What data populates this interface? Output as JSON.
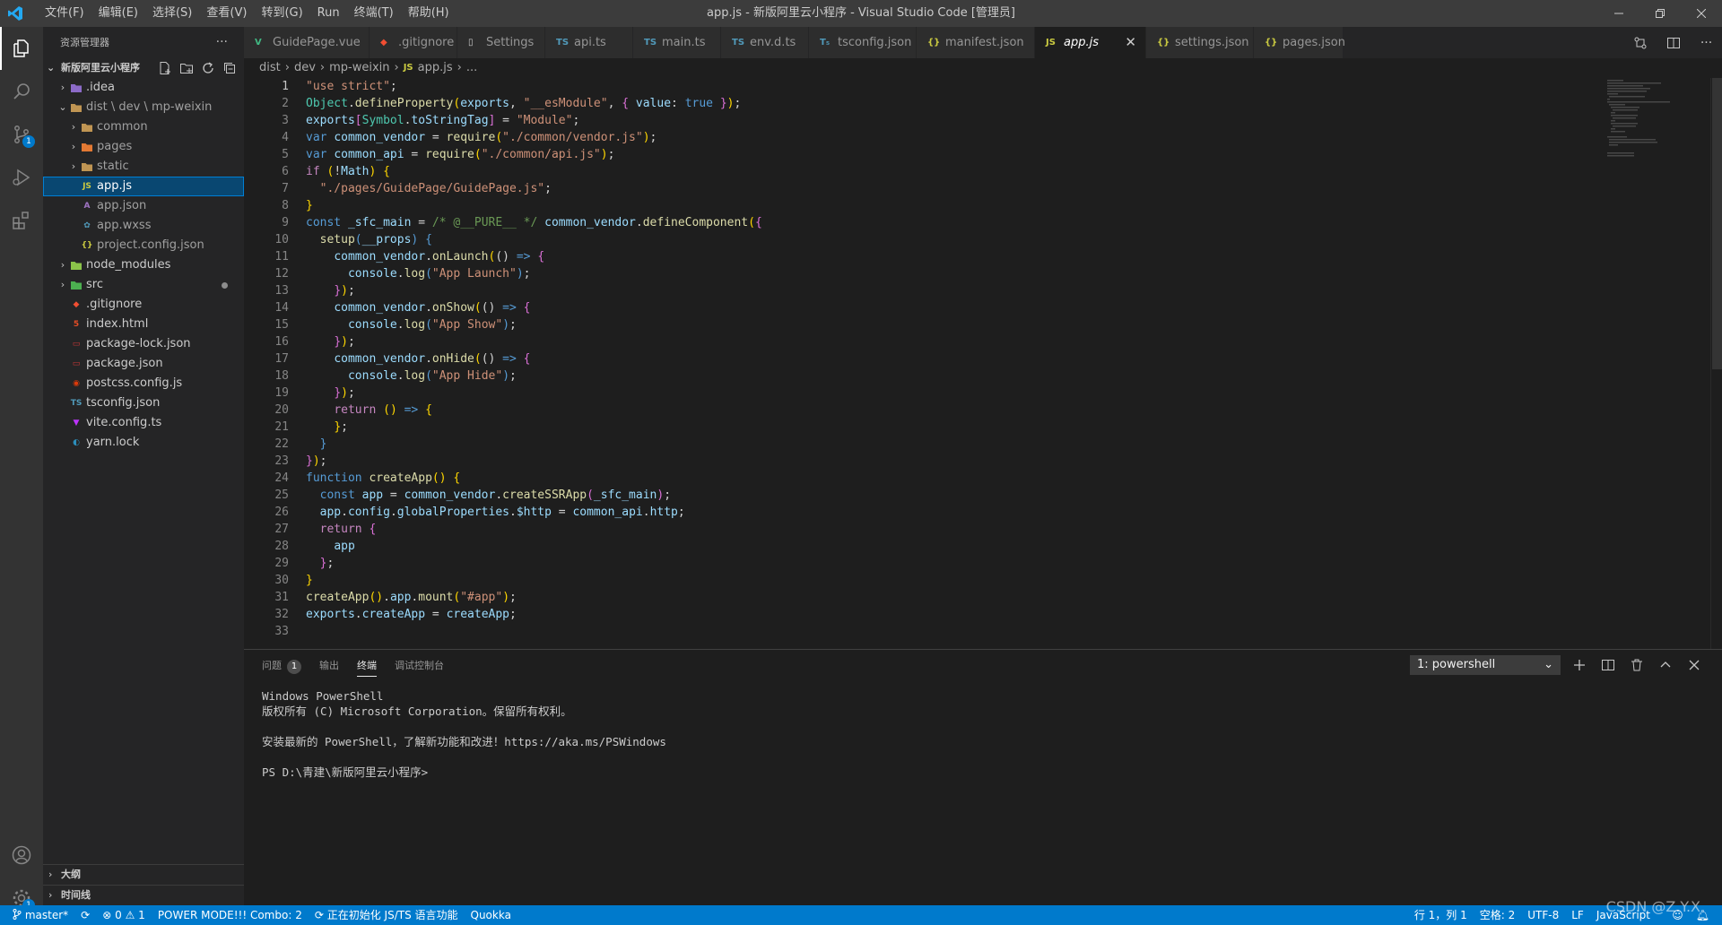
{
  "window": {
    "title": "app.js - 新版阿里云小程序 - Visual Studio Code [管理员]",
    "menu": [
      "文件(F)",
      "编辑(E)",
      "选择(S)",
      "查看(V)",
      "转到(G)",
      "Run",
      "终端(T)",
      "帮助(H)"
    ]
  },
  "activity_bar": {
    "source_control_badge": "1",
    "settings_badge": "1"
  },
  "sidebar": {
    "title": "资源管理器",
    "more": "···",
    "folder": "新版阿里云小程序",
    "tree": [
      {
        "label": "idea",
        "display": ".idea",
        "depth": 1,
        "chevron": "›",
        "icon": "folder-idea"
      },
      {
        "display": "dist \\ dev \\ mp-weixin",
        "depth": 1,
        "chevron": "⌄",
        "icon": "folder-dist"
      },
      {
        "display": "common",
        "depth": 2,
        "chevron": "›",
        "icon": "folder"
      },
      {
        "display": "pages",
        "depth": 2,
        "chevron": "›",
        "icon": "folder-pages"
      },
      {
        "display": "static",
        "depth": 2,
        "chevron": "›",
        "icon": "folder"
      },
      {
        "display": "app.js",
        "depth": 2,
        "icon": "js",
        "selected": true
      },
      {
        "display": "app.json",
        "depth": 2,
        "icon": "json-app"
      },
      {
        "display": "app.wxss",
        "depth": 2,
        "icon": "wxss"
      },
      {
        "display": "project.config.json",
        "depth": 2,
        "icon": "json"
      },
      {
        "display": "node_modules",
        "depth": 1,
        "chevron": "›",
        "icon": "folder-node"
      },
      {
        "display": "src",
        "depth": 1,
        "chevron": "›",
        "icon": "folder-src",
        "dot": true
      },
      {
        "display": ".gitignore",
        "depth": 1,
        "icon": "git"
      },
      {
        "display": "index.html",
        "depth": 1,
        "icon": "html"
      },
      {
        "display": "package-lock.json",
        "depth": 1,
        "icon": "npm"
      },
      {
        "display": "package.json",
        "depth": 1,
        "icon": "npm"
      },
      {
        "display": "postcss.config.js",
        "depth": 1,
        "icon": "postcss"
      },
      {
        "display": "tsconfig.json",
        "depth": 1,
        "icon": "ts"
      },
      {
        "display": "vite.config.ts",
        "depth": 1,
        "icon": "vite"
      },
      {
        "display": "yarn.lock",
        "depth": 1,
        "icon": "yarn"
      }
    ],
    "outline_label": "大纲",
    "timeline_label": "时间线"
  },
  "tabs": [
    {
      "label": "GuidePage.vue",
      "icon": "V",
      "color": "#41b883"
    },
    {
      "label": ".gitignore",
      "icon": "◆",
      "color": "#f14e32"
    },
    {
      "label": "Settings",
      "icon": "▯",
      "color": "#cccccc"
    },
    {
      "label": "api.ts",
      "icon": "TS",
      "color": "#519aba"
    },
    {
      "label": "main.ts",
      "icon": "TS",
      "color": "#519aba"
    },
    {
      "label": "env.d.ts",
      "icon": "TS",
      "color": "#519aba"
    },
    {
      "label": "tsconfig.json",
      "icon": "T₅",
      "color": "#519aba"
    },
    {
      "label": "manifest.json",
      "icon": "{}",
      "color": "#cbcb41"
    },
    {
      "label": "app.js",
      "icon": "JS",
      "color": "#cbcb41",
      "active": true,
      "close": "✕"
    },
    {
      "label": "settings.json",
      "icon": "{}",
      "color": "#cbcb41"
    },
    {
      "label": "pages.json",
      "icon": "{}",
      "color": "#cbcb41"
    }
  ],
  "breadcrumb": [
    "dist",
    "dev",
    "mp-weixin",
    "app.js",
    "..."
  ],
  "editor": {
    "current_line": 1,
    "lines": [
      [
        [
          "\"use strict\"",
          "s"
        ],
        [
          ";",
          ""
        ]
      ],
      [
        [
          "Object",
          "t"
        ],
        [
          ".",
          "",
          ""
        ],
        [
          "defineProperty",
          "f"
        ],
        [
          "(",
          "g"
        ],
        [
          "exports",
          "v"
        ],
        [
          ", ",
          ""
        ],
        [
          "\"__esModule\"",
          "s"
        ],
        [
          ", ",
          ""
        ],
        [
          "{",
          "b"
        ],
        [
          " ",
          ""
        ],
        [
          "value",
          "v"
        ],
        [
          ": ",
          ""
        ],
        [
          "true",
          "k"
        ],
        [
          " ",
          ""
        ],
        [
          "}",
          "b"
        ],
        [
          ")",
          "g"
        ],
        [
          ";",
          ""
        ]
      ],
      [
        [
          "exports",
          "v"
        ],
        [
          "[",
          "b"
        ],
        [
          "Symbol",
          "t"
        ],
        [
          ".",
          ""
        ],
        [
          "toStringTag",
          "v"
        ],
        [
          "]",
          "b"
        ],
        [
          " = ",
          ""
        ],
        [
          "\"Module\"",
          "s"
        ],
        [
          ";",
          ""
        ]
      ],
      [
        [
          "var",
          "k"
        ],
        [
          " ",
          ""
        ],
        [
          "common_vendor",
          "v"
        ],
        [
          " = ",
          ""
        ],
        [
          "require",
          "f"
        ],
        [
          "(",
          "g"
        ],
        [
          "\"./common/vendor.js\"",
          "s"
        ],
        [
          ")",
          "g"
        ],
        [
          ";",
          ""
        ]
      ],
      [
        [
          "var",
          "k"
        ],
        [
          " ",
          ""
        ],
        [
          "common_api",
          "v"
        ],
        [
          " = ",
          ""
        ],
        [
          "require",
          "f"
        ],
        [
          "(",
          "g"
        ],
        [
          "\"./common/api.js\"",
          "s"
        ],
        [
          ")",
          "g"
        ],
        [
          ";",
          ""
        ]
      ],
      [
        [
          "if",
          "p"
        ],
        [
          " ",
          ""
        ],
        [
          "(",
          "g"
        ],
        [
          "!",
          ""
        ],
        [
          "Math",
          "v"
        ],
        [
          ")",
          "g"
        ],
        [
          " ",
          ""
        ],
        [
          "{",
          "g"
        ]
      ],
      [
        [
          "  ",
          ""
        ],
        [
          "\"./pages/GuidePage/GuidePage.js\"",
          "s"
        ],
        [
          ";",
          ""
        ]
      ],
      [
        [
          "}",
          "g"
        ]
      ],
      [
        [
          "const",
          "k"
        ],
        [
          " ",
          ""
        ],
        [
          "_sfc_main",
          "v"
        ],
        [
          " = ",
          ""
        ],
        [
          "/* @__PURE__ */",
          "c"
        ],
        [
          " ",
          ""
        ],
        [
          "common_vendor",
          "v"
        ],
        [
          ".",
          ""
        ],
        [
          "defineComponent",
          "f"
        ],
        [
          "(",
          "g"
        ],
        [
          "{",
          "b"
        ]
      ],
      [
        [
          "  ",
          ""
        ],
        [
          "setup",
          "f"
        ],
        [
          "(",
          "k"
        ],
        [
          "__props",
          "v"
        ],
        [
          ")",
          "k"
        ],
        [
          " ",
          ""
        ],
        [
          "{",
          "k"
        ]
      ],
      [
        [
          "    ",
          ""
        ],
        [
          "common_vendor",
          "v"
        ],
        [
          ".",
          ""
        ],
        [
          "onLaunch",
          "f"
        ],
        [
          "(",
          "g"
        ],
        [
          "(",
          ""
        ],
        [
          ")",
          ""
        ],
        [
          " => ",
          "k"
        ],
        [
          "{",
          "b"
        ]
      ],
      [
        [
          "      ",
          ""
        ],
        [
          "console",
          "v"
        ],
        [
          ".",
          ""
        ],
        [
          "log",
          "f"
        ],
        [
          "(",
          "k"
        ],
        [
          "\"App Launch\"",
          "s"
        ],
        [
          ")",
          "k"
        ],
        [
          ";",
          ""
        ]
      ],
      [
        [
          "    ",
          ""
        ],
        [
          "}",
          "b"
        ],
        [
          ")",
          "g"
        ],
        [
          ";",
          ""
        ]
      ],
      [
        [
          "    ",
          ""
        ],
        [
          "common_vendor",
          "v"
        ],
        [
          ".",
          ""
        ],
        [
          "onShow",
          "f"
        ],
        [
          "(",
          "g"
        ],
        [
          "(",
          ""
        ],
        [
          ")",
          ""
        ],
        [
          " => ",
          "k"
        ],
        [
          "{",
          "b"
        ]
      ],
      [
        [
          "      ",
          ""
        ],
        [
          "console",
          "v"
        ],
        [
          ".",
          ""
        ],
        [
          "log",
          "f"
        ],
        [
          "(",
          "k"
        ],
        [
          "\"App Show\"",
          "s"
        ],
        [
          ")",
          "k"
        ],
        [
          ";",
          ""
        ]
      ],
      [
        [
          "    ",
          ""
        ],
        [
          "}",
          "b"
        ],
        [
          ")",
          "g"
        ],
        [
          ";",
          ""
        ]
      ],
      [
        [
          "    ",
          ""
        ],
        [
          "common_vendor",
          "v"
        ],
        [
          ".",
          ""
        ],
        [
          "onHide",
          "f"
        ],
        [
          "(",
          "g"
        ],
        [
          "(",
          ""
        ],
        [
          ")",
          ""
        ],
        [
          " => ",
          "k"
        ],
        [
          "{",
          "b"
        ]
      ],
      [
        [
          "      ",
          ""
        ],
        [
          "console",
          "v"
        ],
        [
          ".",
          ""
        ],
        [
          "log",
          "f"
        ],
        [
          "(",
          "k"
        ],
        [
          "\"App Hide\"",
          "s"
        ],
        [
          ")",
          "k"
        ],
        [
          ";",
          ""
        ]
      ],
      [
        [
          "    ",
          ""
        ],
        [
          "}",
          "b"
        ],
        [
          ")",
          "g"
        ],
        [
          ";",
          ""
        ]
      ],
      [
        [
          "    ",
          ""
        ],
        [
          "return",
          "p"
        ],
        [
          " ",
          ""
        ],
        [
          "(",
          "g"
        ],
        [
          ")",
          "g"
        ],
        [
          " => ",
          "k"
        ],
        [
          "{",
          "g"
        ]
      ],
      [
        [
          "    ",
          ""
        ],
        [
          "}",
          "g"
        ],
        [
          ";",
          ""
        ]
      ],
      [
        [
          "  ",
          ""
        ],
        [
          "}",
          "k"
        ]
      ],
      [
        [
          "}",
          "b"
        ],
        [
          ")",
          "g"
        ],
        [
          ";",
          ""
        ]
      ],
      [
        [
          "function",
          "k"
        ],
        [
          " ",
          ""
        ],
        [
          "createApp",
          "f"
        ],
        [
          "(",
          "g"
        ],
        [
          ")",
          "g"
        ],
        [
          " ",
          ""
        ],
        [
          "{",
          "g"
        ]
      ],
      [
        [
          "  ",
          ""
        ],
        [
          "const",
          "k"
        ],
        [
          " ",
          ""
        ],
        [
          "app",
          "v"
        ],
        [
          " = ",
          ""
        ],
        [
          "common_vendor",
          "v"
        ],
        [
          ".",
          ""
        ],
        [
          "createSSRApp",
          "f"
        ],
        [
          "(",
          "b"
        ],
        [
          "_sfc_main",
          "v"
        ],
        [
          ")",
          "b"
        ],
        [
          ";",
          ""
        ]
      ],
      [
        [
          "  ",
          ""
        ],
        [
          "app",
          "v"
        ],
        [
          ".",
          ""
        ],
        [
          "config",
          "v"
        ],
        [
          ".",
          ""
        ],
        [
          "globalProperties",
          "v"
        ],
        [
          ".",
          ""
        ],
        [
          "$http",
          "v"
        ],
        [
          " = ",
          ""
        ],
        [
          "common_api",
          "v"
        ],
        [
          ".",
          ""
        ],
        [
          "http",
          "v"
        ],
        [
          ";",
          ""
        ]
      ],
      [
        [
          "  ",
          ""
        ],
        [
          "return",
          "p"
        ],
        [
          " ",
          ""
        ],
        [
          "{",
          "b"
        ]
      ],
      [
        [
          "    ",
          ""
        ],
        [
          "app",
          "v"
        ]
      ],
      [
        [
          "  ",
          ""
        ],
        [
          "}",
          "b"
        ],
        [
          ";",
          ""
        ]
      ],
      [
        [
          "}",
          "g"
        ]
      ],
      [
        [
          "createApp",
          "f"
        ],
        [
          "(",
          "g"
        ],
        [
          ")",
          "g"
        ],
        [
          ".",
          ""
        ],
        [
          "app",
          "v"
        ],
        [
          ".",
          ""
        ],
        [
          "mount",
          "f"
        ],
        [
          "(",
          "g"
        ],
        [
          "\"#app\"",
          "s"
        ],
        [
          ")",
          "g"
        ],
        [
          ";",
          ""
        ]
      ],
      [
        [
          "exports",
          "v"
        ],
        [
          ".",
          ""
        ],
        [
          "createApp",
          "v"
        ],
        [
          " = ",
          ""
        ],
        [
          "createApp",
          "v"
        ],
        [
          ";",
          ""
        ]
      ],
      []
    ]
  },
  "panel": {
    "tabs": [
      {
        "label": "问题",
        "count": "1"
      },
      {
        "label": "输出"
      },
      {
        "label": "终端",
        "active": true
      },
      {
        "label": "调试控制台"
      }
    ],
    "terminal_selector": "1: powershell",
    "terminal_lines": [
      "Windows PowerShell",
      "版权所有 (C) Microsoft Corporation。保留所有权利。",
      "",
      "安装最新的 PowerShell，了解新功能和改进！https://aka.ms/PSWindows",
      "",
      "PS D:\\青建\\新版阿里云小程序>"
    ]
  },
  "statusbar": {
    "branch": "master*",
    "errors": "0",
    "warnings": "1",
    "power_mode": "POWER MODE!!! Combo: 2",
    "ts_status": "正在初始化 JS/TS 语言功能",
    "quokka": "Quokka",
    "position": "行 1，列 1",
    "spaces": "空格: 2",
    "encoding": "UTF-8",
    "eol": "LF",
    "language": "JavaScript"
  },
  "watermark": "CSDN @Z.Y.X"
}
